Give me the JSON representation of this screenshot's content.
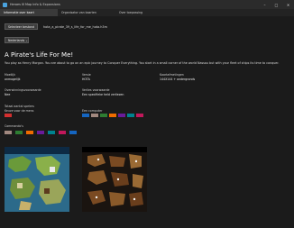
{
  "window": {
    "title": "Heroes III Map Info & Expansions"
  },
  "tabs": [
    {
      "label": "Informatie over kaart"
    },
    {
      "label": "Organisator van kaarten"
    },
    {
      "label": "Over toepassing"
    }
  ],
  "toolbar": {
    "choose_map_label": "Selecteer bestand",
    "file_path": "hota_a_pirate_39_s_life_for_me_hota.h3m",
    "language_label": "Nederlands ⌄"
  },
  "map": {
    "name": "A Pirate's Life For Me!",
    "description": "You play as Henry Morgan. You are about to go on an epic journey to Conquer Everything. You start in a small corner of the world Nassau but with your fleet of ships its time to conquer."
  },
  "info": {
    "difficulty_label": "Moeilijk",
    "difficulty_value": "onmogelijk",
    "version_label": "Versie",
    "version_value": "HOTA",
    "size_label": "Kaartafmetingen",
    "size_value": "144X144 + ondergronds",
    "win_label": "Overwinningsvoorwaarde",
    "win_value": "Nee",
    "loss_label": "Verlies voorwaarde",
    "loss_value": "Een specifieke held verliezen",
    "players_label": "Totaal aantal spelers",
    "players_sub_label": "Keuze voor de mens",
    "computer_label": "Een computer",
    "commanders_label": "Commando's"
  },
  "colors": {
    "human": [
      "#d32f2f"
    ],
    "computer": [
      "#1565c0",
      "#a1887f",
      "#2e7d32",
      "#ef6c00",
      "#6a1b9a",
      "#00838f",
      "#c2185b"
    ],
    "commanders": [
      "#a1887f",
      "#2e7d32",
      "#ef6c00",
      "#6a1b9a",
      "#00838f",
      "#c2185b",
      "#1565c0"
    ]
  }
}
